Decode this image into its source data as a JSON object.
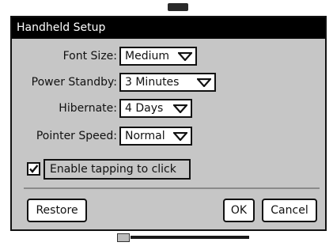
{
  "dialog": {
    "title": "Handheld Setup"
  },
  "settings": {
    "font_size": {
      "label": "Font Size:",
      "value": "Medium"
    },
    "power_standby": {
      "label": "Power Standby:",
      "value": "3 Minutes"
    },
    "hibernate": {
      "label": "Hibernate:",
      "value": "4 Days"
    },
    "pointer_speed": {
      "label": "Pointer Speed:",
      "value": "Normal"
    }
  },
  "enable_tapping": {
    "label": "Enable tapping to click",
    "checked": true
  },
  "buttons": {
    "restore": "Restore",
    "ok": "OK",
    "cancel": "Cancel"
  },
  "icons": {
    "dropdown_arrow": "chevron-down-icon",
    "checkmark": "checkmark-icon"
  },
  "colors": {
    "dialog_bg": "#c6c6c6",
    "titlebar_bg": "#000000",
    "titlebar_text": "#ffffff"
  }
}
